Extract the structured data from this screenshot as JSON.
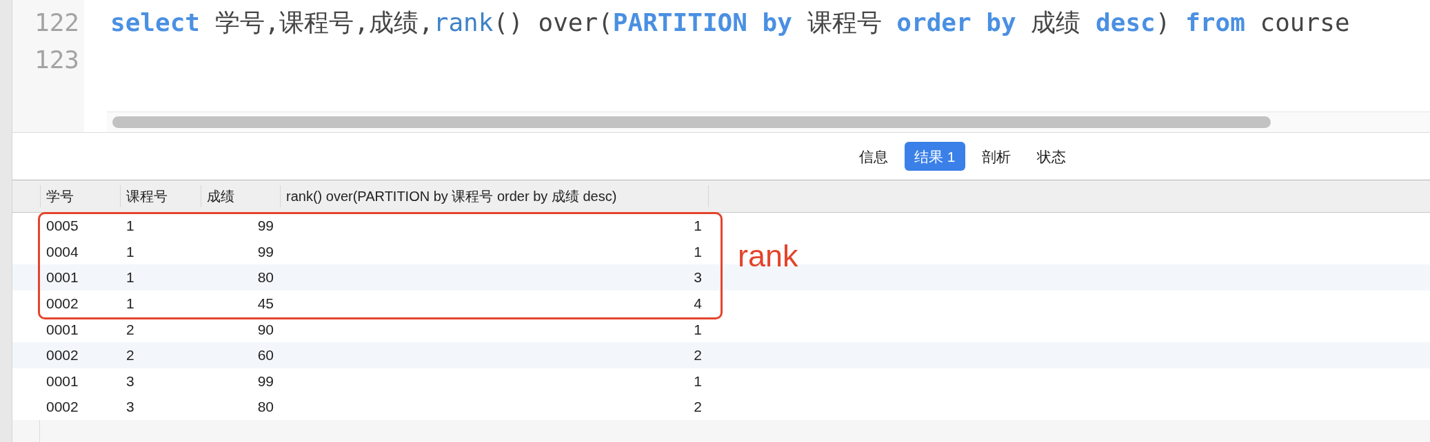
{
  "editor": {
    "lines": [
      {
        "number": "122",
        "tokens": [
          {
            "text": "select",
            "kind": "keyword"
          },
          {
            "text": " 学号,课程号,成绩,",
            "kind": "plain"
          },
          {
            "text": "rank",
            "kind": "function"
          },
          {
            "text": "() over(",
            "kind": "plain"
          },
          {
            "text": "PARTITION",
            "kind": "keyword"
          },
          {
            "text": " by",
            "kind": "keyword"
          },
          {
            "text": " 课程号 ",
            "kind": "plain"
          },
          {
            "text": "order",
            "kind": "keyword"
          },
          {
            "text": " by",
            "kind": "keyword"
          },
          {
            "text": " 成绩 ",
            "kind": "plain"
          },
          {
            "text": "desc",
            "kind": "keyword"
          },
          {
            "text": ") ",
            "kind": "plain"
          },
          {
            "text": "from",
            "kind": "keyword"
          },
          {
            "text": " course",
            "kind": "plain"
          }
        ]
      },
      {
        "number": "123"
      }
    ]
  },
  "tabs": [
    {
      "label": "信息",
      "selected": false
    },
    {
      "label": "结果 1",
      "selected": true
    },
    {
      "label": "剖析",
      "selected": false
    },
    {
      "label": "状态",
      "selected": false
    }
  ],
  "table": {
    "columns": [
      {
        "label": "学号",
        "kind": "text"
      },
      {
        "label": "课程号",
        "kind": "text"
      },
      {
        "label": "成绩",
        "kind": "number"
      },
      {
        "label": "rank() over(PARTITION by 课程号 order by 成绩 desc)",
        "kind": "number"
      }
    ],
    "rows": [
      {
        "cells": [
          "0005",
          "1",
          "99",
          "1"
        ],
        "shaded": false,
        "framed": true
      },
      {
        "cells": [
          "0004",
          "1",
          "99",
          "1"
        ],
        "shaded": false,
        "framed": true
      },
      {
        "cells": [
          "0001",
          "1",
          "80",
          "3"
        ],
        "shaded": true,
        "framed": true
      },
      {
        "cells": [
          "0002",
          "1",
          "45",
          "4"
        ],
        "shaded": false,
        "framed": true
      },
      {
        "cells": [
          "0001",
          "2",
          "90",
          "1"
        ],
        "shaded": false,
        "framed": false
      },
      {
        "cells": [
          "0002",
          "2",
          "60",
          "2"
        ],
        "shaded": true,
        "framed": false
      },
      {
        "cells": [
          "0001",
          "3",
          "99",
          "1"
        ],
        "shaded": false,
        "framed": false
      },
      {
        "cells": [
          "0002",
          "3",
          "80",
          "2"
        ],
        "shaded": false,
        "framed": false
      }
    ]
  },
  "annotation": {
    "label": "rank"
  }
}
